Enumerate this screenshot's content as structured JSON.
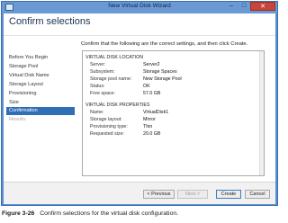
{
  "window": {
    "title": "New Virtual Disk Wizard",
    "minimize_glyph": "–",
    "maximize_glyph": "□",
    "close_glyph": "✕",
    "title_icon": "wizard-app-icon"
  },
  "page": {
    "title": "Confirm selections",
    "intro": "Confirm that the following are the correct settings, and then click Create."
  },
  "steps": [
    {
      "label": "Before You Begin",
      "state": "normal"
    },
    {
      "label": "Storage Pool",
      "state": "normal"
    },
    {
      "label": "Virtual Disk Name",
      "state": "normal"
    },
    {
      "label": "Storage Layout",
      "state": "normal"
    },
    {
      "label": "Provisioning",
      "state": "normal"
    },
    {
      "label": "Size",
      "state": "normal"
    },
    {
      "label": "Confirmation",
      "state": "active"
    },
    {
      "label": "Results",
      "state": "disabled"
    }
  ],
  "location": {
    "heading": "VIRTUAL DISK LOCATION",
    "rows": [
      {
        "label": "Server:",
        "value": "Server2"
      },
      {
        "label": "Subsystem:",
        "value": "Storage Spaces"
      },
      {
        "label": "Storage pool name:",
        "value": "New Storage Pool"
      },
      {
        "label": "Status:",
        "value": "OK"
      },
      {
        "label": "Free space:",
        "value": "57.0 GB"
      }
    ]
  },
  "properties": {
    "heading": "VIRTUAL DISK PROPERTIES",
    "rows": [
      {
        "label": "Name:",
        "value": "VirtualDisk1"
      },
      {
        "label": "Storage layout:",
        "value": "Mirror"
      },
      {
        "label": "Provisioning type:",
        "value": "Thin"
      },
      {
        "label": "Requested size:",
        "value": "20.0 GB"
      }
    ]
  },
  "buttons": {
    "previous": "< Previous",
    "next": "Next >",
    "create": "Create",
    "cancel": "Cancel"
  },
  "caption": {
    "figure": "Figure 3-26",
    "text": "Confirm selections for the virtual disk configuration."
  },
  "colors": {
    "window_frame": "#5b8fce",
    "selected_step": "#2f6fb8",
    "close_button": "#c7453a"
  }
}
